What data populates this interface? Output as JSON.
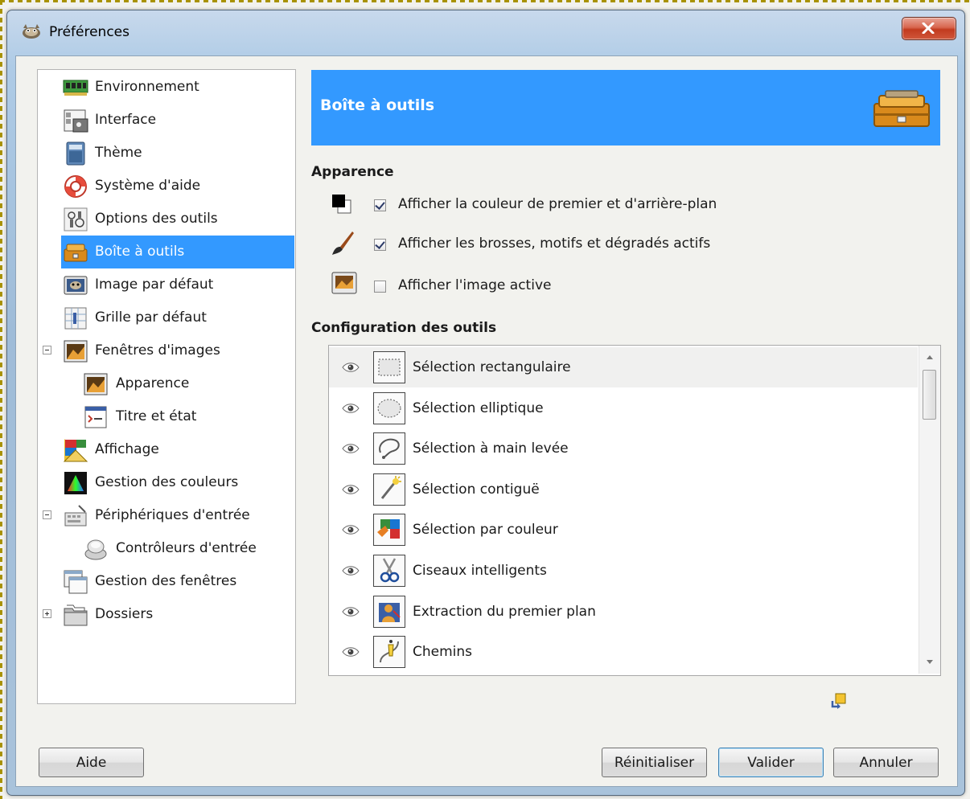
{
  "window": {
    "title": "Préférences"
  },
  "sidebar": {
    "items": [
      {
        "label": "Environnement",
        "icon": "memory-chip-icon"
      },
      {
        "label": "Interface",
        "icon": "interface-icon"
      },
      {
        "label": "Thème",
        "icon": "theme-icon"
      },
      {
        "label": "Système d'aide",
        "icon": "lifebuoy-icon"
      },
      {
        "label": "Options des outils",
        "icon": "tool-options-icon"
      },
      {
        "label": "Boîte à outils",
        "icon": "toolbox-icon",
        "selected": true
      },
      {
        "label": "Image par défaut",
        "icon": "default-image-icon"
      },
      {
        "label": "Grille par défaut",
        "icon": "grid-icon"
      },
      {
        "label": "Fenêtres d'images",
        "icon": "image-window-icon",
        "expander": "minus"
      },
      {
        "label": "Apparence",
        "icon": "image-window-icon",
        "child": true
      },
      {
        "label": "Titre et état",
        "icon": "title-status-icon",
        "child": true
      },
      {
        "label": "Affichage",
        "icon": "display-icon"
      },
      {
        "label": "Gestion des couleurs",
        "icon": "color-management-icon"
      },
      {
        "label": "Périphériques d'entrée",
        "icon": "input-devices-icon",
        "expander": "minus"
      },
      {
        "label": "Contrôleurs d'entrée",
        "icon": "input-controllers-icon",
        "child": true
      },
      {
        "label": "Gestion des fenêtres",
        "icon": "window-management-icon"
      },
      {
        "label": "Dossiers",
        "icon": "folders-icon",
        "expander": "plus"
      }
    ]
  },
  "banner": {
    "title": "Boîte à outils",
    "icon": "toolbox-icon"
  },
  "appearance": {
    "heading": "Apparence",
    "options": [
      {
        "label": "Afficher la couleur de premier et d'arrière-plan",
        "checked": true,
        "icon": "fg-bg-color-icon"
      },
      {
        "label": "Afficher les brosses, motifs et dégradés actifs",
        "checked": true,
        "icon": "paintbrush-icon"
      },
      {
        "label": "Afficher l'image active",
        "checked": false,
        "icon": "active-image-icon"
      }
    ]
  },
  "tools": {
    "heading": "Configuration des outils",
    "items": [
      {
        "label": "Sélection rectangulaire",
        "icon": "rect-select-icon"
      },
      {
        "label": "Sélection elliptique",
        "icon": "ellipse-select-icon"
      },
      {
        "label": "Sélection à main levée",
        "icon": "free-select-icon"
      },
      {
        "label": "Sélection contiguë",
        "icon": "fuzzy-select-icon"
      },
      {
        "label": "Sélection par couleur",
        "icon": "color-select-icon"
      },
      {
        "label": "Ciseaux intelligents",
        "icon": "scissors-icon"
      },
      {
        "label": "Extraction du premier plan",
        "icon": "foreground-select-icon"
      },
      {
        "label": "Chemins",
        "icon": "paths-icon"
      }
    ]
  },
  "buttons": {
    "help": "Aide",
    "reset": "Réinitialiser",
    "ok": "Valider",
    "cancel": "Annuler"
  }
}
